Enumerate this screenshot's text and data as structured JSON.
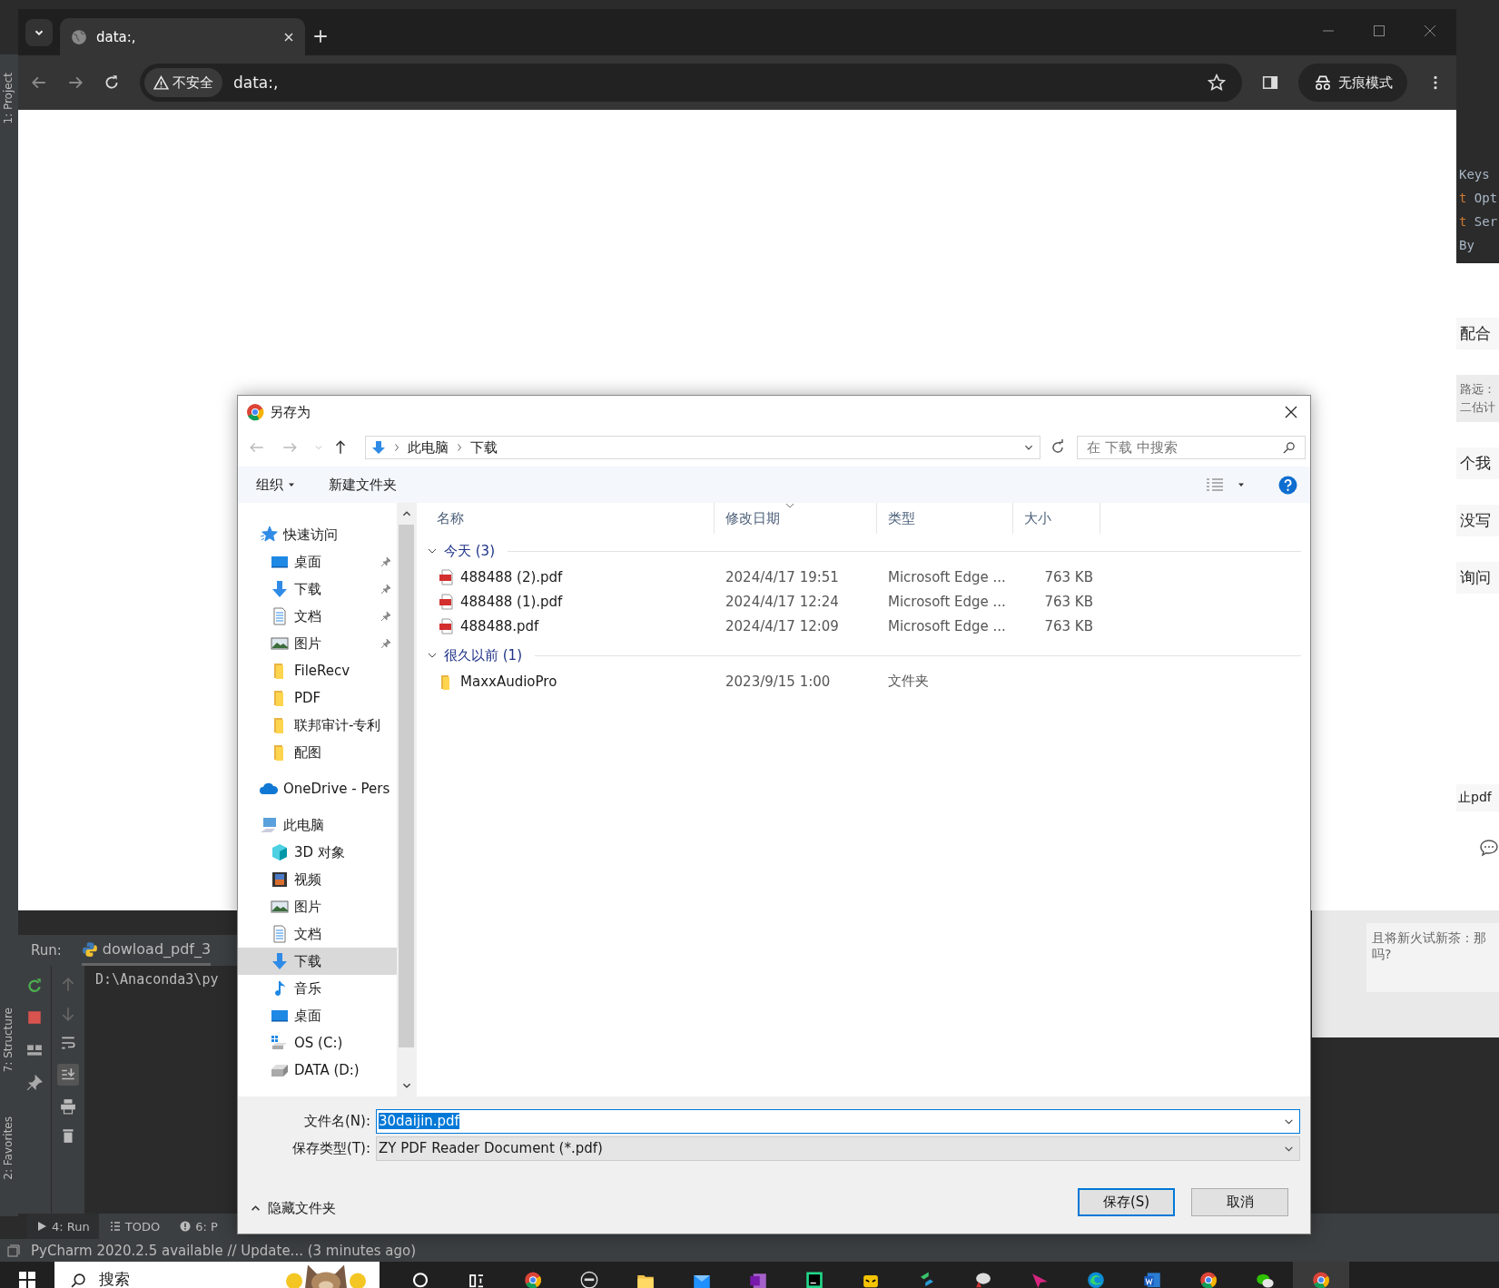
{
  "ide": {
    "side_tabs": [
      {
        "label": "1: Project"
      },
      {
        "label": "7: Structure"
      },
      {
        "label": "2: Favorites"
      }
    ],
    "code_lines": [
      {
        "text": "Keys"
      },
      {
        "keyword": "t",
        "text": " Opt"
      },
      {
        "keyword": "t",
        "text": " Ser"
      },
      {
        "text": "By"
      }
    ],
    "run": {
      "label": "Run:",
      "tab": "dowload_pdf_3",
      "console": "D:\\Anaconda3\\py"
    },
    "tool_tabs": [
      {
        "label": "4: Run",
        "kind": "run",
        "selected": true
      },
      {
        "label": "TODO",
        "kind": "todo",
        "selected": false
      },
      {
        "label": "6: P",
        "kind": "problems",
        "selected": false
      }
    ],
    "status": "PyCharm 2020.2.5 available // Update... (3 minutes ago)"
  },
  "chat": {
    "fragments": [
      {
        "kind": "message",
        "lines": [
          "配合"
        ]
      },
      {
        "kind": "quote",
        "lines": [
          "路远：",
          "二估计"
        ]
      },
      {
        "kind": "message",
        "lines": [
          "个我"
        ]
      },
      {
        "kind": "message",
        "lines": [
          "没写"
        ]
      },
      {
        "kind": "message",
        "lines": [
          "询问"
        ]
      },
      {
        "kind": "message",
        "lines": [
          "止pdf"
        ]
      }
    ],
    "reply_quote": [
      "且将新火试新茶：那",
      "吗?"
    ]
  },
  "browser": {
    "tabs": [
      {
        "title": "data:,",
        "selected": true
      }
    ],
    "security": "不安全",
    "url": "data:,",
    "profile": "无痕模式"
  },
  "dialog": {
    "title": "另存为",
    "breadcrumbs": [
      "此电脑",
      "下载"
    ],
    "search": {
      "placeholder": "在 下载 中搜索"
    },
    "commands": [
      "组织",
      "新建文件夹"
    ],
    "columns": [
      {
        "label": "名称",
        "sorted": false
      },
      {
        "label": "修改日期",
        "sorted": true
      },
      {
        "label": "类型",
        "sorted": false
      },
      {
        "label": "大小",
        "sorted": false
      }
    ],
    "nav": [
      {
        "label": "快速访问",
        "kind": "star",
        "selected": false,
        "children": [
          {
            "label": "桌面",
            "kind": "desktop",
            "pinned": true,
            "selected": false
          },
          {
            "label": "下载",
            "kind": "download",
            "pinned": true,
            "selected": false
          },
          {
            "label": "文档",
            "kind": "document",
            "pinned": true,
            "selected": false
          },
          {
            "label": "图片",
            "kind": "picture",
            "pinned": true,
            "selected": false
          },
          {
            "label": "FileRecv",
            "kind": "folder",
            "pinned": false,
            "selected": false
          },
          {
            "label": "PDF",
            "kind": "folder",
            "pinned": false,
            "selected": false
          },
          {
            "label": "联邦审计-专利",
            "kind": "folder",
            "pinned": false,
            "selected": false
          },
          {
            "label": "配图",
            "kind": "folder",
            "pinned": false,
            "selected": false
          }
        ]
      },
      {
        "label": "OneDrive - Pers",
        "kind": "cloud",
        "selected": false
      },
      {
        "label": "此电脑",
        "kind": "pc",
        "selected": false,
        "children": [
          {
            "label": "3D 对象",
            "kind": "cube",
            "pinned": false,
            "selected": false
          },
          {
            "label": "视频",
            "kind": "video",
            "pinned": false,
            "selected": false
          },
          {
            "label": "图片",
            "kind": "picture",
            "pinned": false,
            "selected": false
          },
          {
            "label": "文档",
            "kind": "document",
            "pinned": false,
            "selected": false
          },
          {
            "label": "下载",
            "kind": "download",
            "pinned": false,
            "selected": true
          },
          {
            "label": "音乐",
            "kind": "music",
            "pinned": false,
            "selected": false
          },
          {
            "label": "桌面",
            "kind": "desktop",
            "pinned": false,
            "selected": false
          },
          {
            "label": "OS (C:)",
            "kind": "drive-os",
            "pinned": false,
            "selected": false
          },
          {
            "label": "DATA (D:)",
            "kind": "drive",
            "pinned": false,
            "selected": false
          }
        ]
      }
    ],
    "groups": [
      {
        "label": "今天 (3)",
        "expanded": true,
        "rows": [
          {
            "kind": "pdf",
            "name": "488488 (2).pdf",
            "date": "2024/4/17 19:51",
            "type": "Microsoft Edge ...",
            "size": "763 KB"
          },
          {
            "kind": "pdf",
            "name": "488488 (1).pdf",
            "date": "2024/4/17 12:24",
            "type": "Microsoft Edge ...",
            "size": "763 KB"
          },
          {
            "kind": "pdf",
            "name": "488488.pdf",
            "date": "2024/4/17 12:09",
            "type": "Microsoft Edge ...",
            "size": "763 KB"
          }
        ]
      },
      {
        "label": "很久以前 (1)",
        "expanded": true,
        "rows": [
          {
            "kind": "folder",
            "name": "MaxxAudioPro",
            "date": "2023/9/15 1:00",
            "type": "文件夹"
          }
        ]
      }
    ],
    "file_name": {
      "label": "文件名(N):",
      "value": "30daijin.pdf",
      "text_selected": true
    },
    "file_type": {
      "label": "保存类型(T):",
      "value": "ZY PDF Reader Document (*.pdf)"
    },
    "hide_folders": "隐藏文件夹",
    "buttons": [
      {
        "label": "保存(S)",
        "default": true
      },
      {
        "label": "取消",
        "default": false
      }
    ]
  },
  "taskbar": {
    "search": "搜索",
    "apps": [
      {
        "kind": "search",
        "active": false
      },
      {
        "kind": "task-view",
        "active": false
      },
      {
        "kind": "chrome",
        "active": false
      },
      {
        "kind": "dell",
        "active": false
      },
      {
        "kind": "files",
        "active": false
      },
      {
        "kind": "mail",
        "active": false
      },
      {
        "kind": "onenote",
        "active": false
      },
      {
        "kind": "pycharm",
        "active": false
      },
      {
        "kind": "mask",
        "active": false
      },
      {
        "kind": "stack",
        "active": false
      },
      {
        "kind": "dish",
        "active": false
      },
      {
        "kind": "plane",
        "active": false
      },
      {
        "kind": "edge",
        "active": false
      },
      {
        "kind": "word",
        "active": false
      },
      {
        "kind": "chrome",
        "active": false
      },
      {
        "kind": "wechat",
        "active": false
      },
      {
        "kind": "chrome",
        "active": true
      }
    ]
  }
}
